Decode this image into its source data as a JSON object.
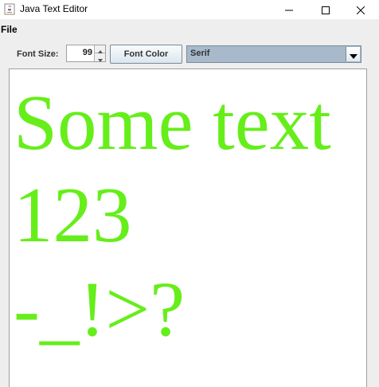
{
  "window": {
    "title": "Java Text Editor",
    "icon": "java-coffee-cup-icon"
  },
  "window_controls": {
    "minimize_icon": "minimize-icon",
    "maximize_icon": "maximize-icon",
    "close_icon": "close-icon"
  },
  "menubar": {
    "file_label": "File"
  },
  "toolbar": {
    "font_size_label": "Font Size:",
    "font_size_value": "99",
    "font_color_label": "Font Color",
    "font_family_value": "Serif"
  },
  "editor": {
    "lines": [
      "Some text",
      "123",
      "-_!>?"
    ],
    "text_color": "#66ee1a"
  }
}
